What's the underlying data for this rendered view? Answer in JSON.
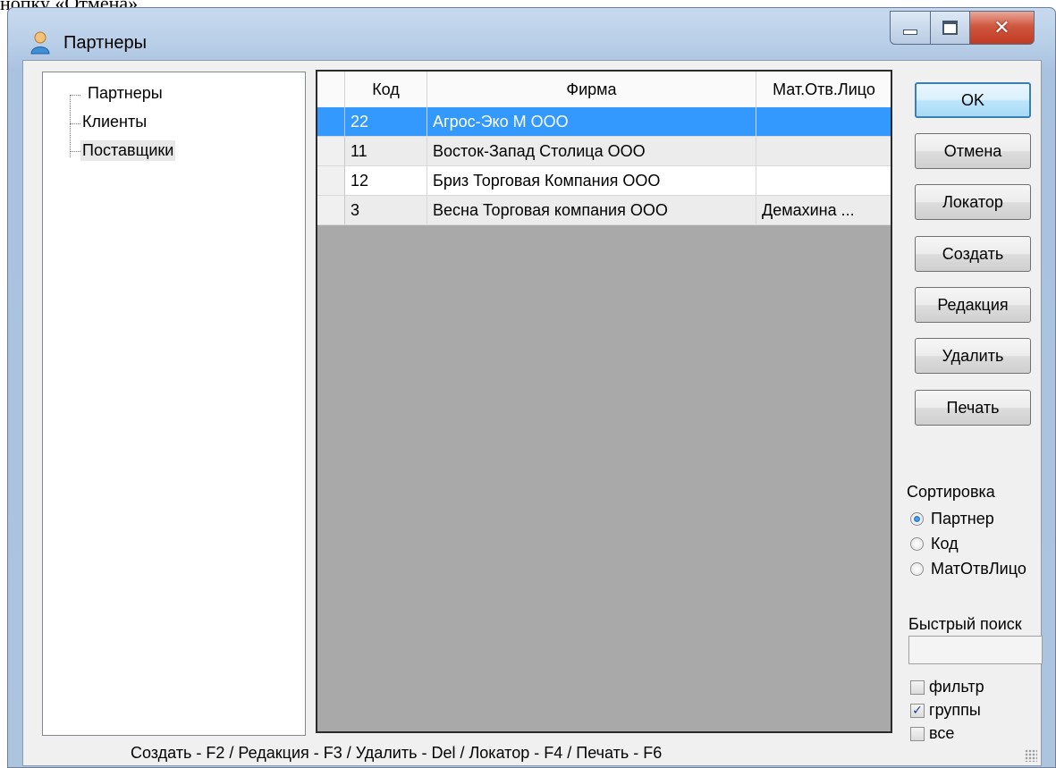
{
  "page_top_text": "нопку «Отмена».",
  "window": {
    "title": "Партнеры",
    "icon": "user-icon",
    "controls": {
      "minimize": "minimize-icon",
      "maximize": "maximize-icon",
      "close": "close-icon"
    }
  },
  "tree": {
    "items": [
      {
        "label": "Партнеры"
      },
      {
        "label": "Клиенты"
      },
      {
        "label": "Поставщики"
      }
    ]
  },
  "grid": {
    "columns": [
      "Код",
      "Фирма",
      "Мат.Отв.Лицо"
    ],
    "rows": [
      {
        "code": "22",
        "firm": "Агрос-Эко М ООО",
        "person": ""
      },
      {
        "code": "11",
        "firm": "Восток-Запад Столица ООО",
        "person": ""
      },
      {
        "code": "12",
        "firm": "Бриз Торговая Компания ООО",
        "person": ""
      },
      {
        "code": "3",
        "firm": "Весна Торговая компания ООО",
        "person": "Демахина ..."
      }
    ],
    "selected_row": 0,
    "selection_color": "#3399ff"
  },
  "buttons": {
    "ok": "OK",
    "cancel": "Отмена",
    "locator": "Локатор",
    "create": "Создать",
    "edit": "Редакция",
    "delete": "Удалить",
    "print": "Печать"
  },
  "sort": {
    "label": "Сортировка",
    "options": [
      "Партнер",
      "Код",
      "МатОтвЛицо"
    ],
    "selected": "Партнер"
  },
  "quick_search": {
    "label": "Быстрый поиск",
    "value": ""
  },
  "checkboxes": [
    {
      "label": "фильтр",
      "checked": false
    },
    {
      "label": "группы",
      "checked": true
    },
    {
      "label": "все",
      "checked": false
    }
  ],
  "status": "Создать - F2 / Редакция - F3 / Удалить - Del / Локатор - F4 / Печать - F6"
}
